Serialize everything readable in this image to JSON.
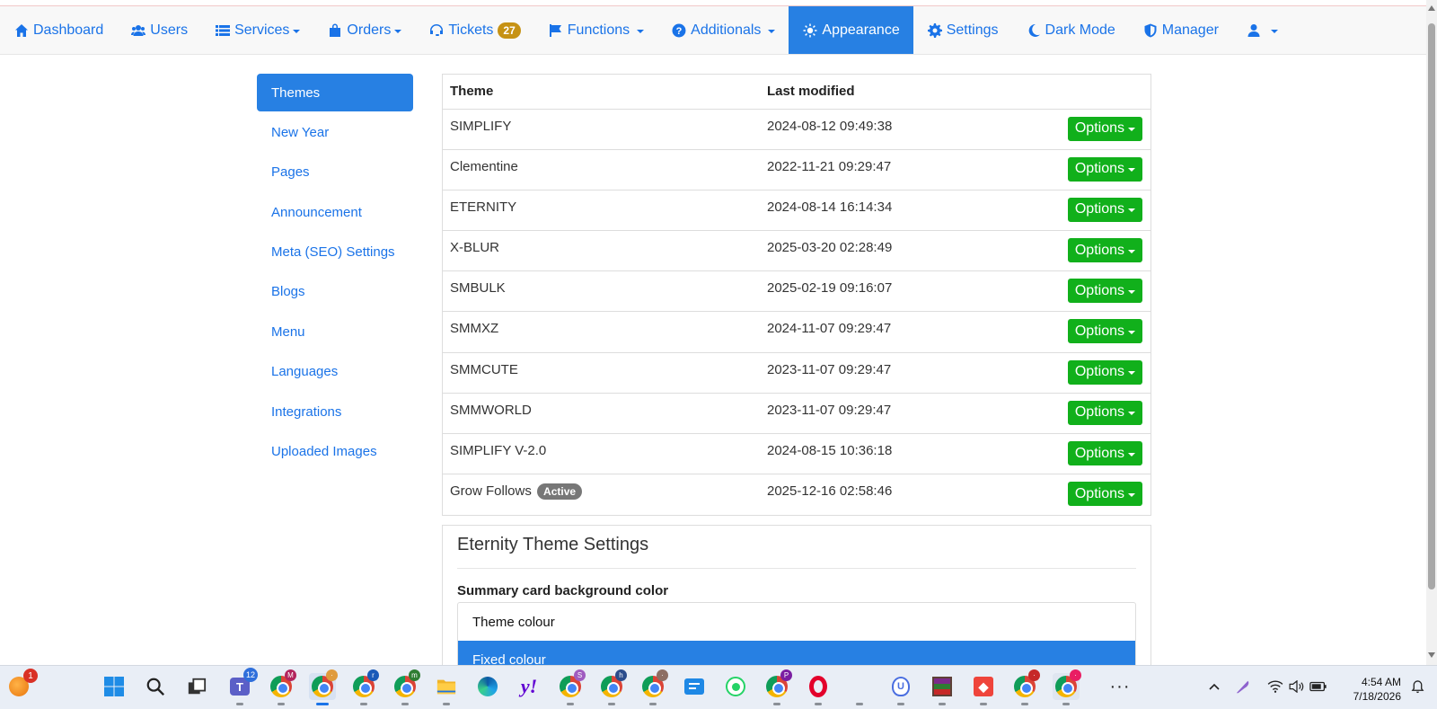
{
  "navbar": {
    "items": [
      {
        "label": "Dashboard",
        "icon": "home-icon"
      },
      {
        "label": "Users",
        "icon": "users-icon"
      },
      {
        "label": "Services",
        "icon": "list-icon"
      },
      {
        "label": "Orders",
        "icon": "shopping-bag-icon"
      },
      {
        "label": "Tickets",
        "icon": "headset-icon",
        "badge": "27"
      },
      {
        "label": "Functions",
        "icon": "flag-icon"
      },
      {
        "label": "Additionals",
        "icon": "question-circle-icon"
      },
      {
        "label": "Appearance",
        "icon": "sun-icon",
        "active": true
      },
      {
        "label": "Settings",
        "icon": "gear-icon"
      },
      {
        "label": "Dark Mode",
        "icon": "moon-icon"
      },
      {
        "label": "Manager",
        "icon": "shield-icon"
      }
    ],
    "account_icon": "user-icon"
  },
  "sidebar": {
    "items": [
      {
        "label": "Themes",
        "active": true
      },
      {
        "label": "New Year"
      },
      {
        "label": "Pages"
      },
      {
        "label": "Announcement"
      },
      {
        "label": "Meta (SEO) Settings"
      },
      {
        "label": "Blogs"
      },
      {
        "label": "Menu"
      },
      {
        "label": "Languages"
      },
      {
        "label": "Integrations"
      },
      {
        "label": "Uploaded Images"
      }
    ]
  },
  "themes_table": {
    "headers": {
      "theme": "Theme",
      "modified": "Last modified"
    },
    "options_label": "Options",
    "active_label": "Active",
    "rows": [
      {
        "name": "SIMPLIFY",
        "modified": "2024-08-12 09:49:38"
      },
      {
        "name": "Clementine",
        "modified": "2022-11-21 09:29:47"
      },
      {
        "name": "ETERNITY",
        "modified": "2024-08-14 16:14:34"
      },
      {
        "name": "X-BLUR",
        "modified": "2025-03-20 02:28:49"
      },
      {
        "name": "SMBULK",
        "modified": "2025-02-19 09:16:07"
      },
      {
        "name": "SMMXZ",
        "modified": "2024-11-07 09:29:47"
      },
      {
        "name": "SMMCUTE",
        "modified": "2023-11-07 09:29:47"
      },
      {
        "name": "SMMWORLD",
        "modified": "2023-11-07 09:29:47"
      },
      {
        "name": "SIMPLIFY V-2.0",
        "modified": "2024-08-15 10:36:18"
      },
      {
        "name": "Grow Follows",
        "modified": "2025-12-16 02:58:46",
        "active": true
      }
    ]
  },
  "theme_settings": {
    "title": "Eternity Theme Settings",
    "field_label": "Summary card background color",
    "options": [
      "Theme colour",
      "Fixed colour"
    ],
    "selected": "Fixed colour"
  },
  "taskbar": {
    "notification_badge": "1",
    "teams_badge": "12",
    "time": "4:54 AM",
    "date": "7/18/2026"
  },
  "colors": {
    "accent": "#2780e3",
    "link": "#1a73e8",
    "options_button": "#11b01b",
    "tickets_badge": "#c69214",
    "active_badge": "#777777"
  }
}
